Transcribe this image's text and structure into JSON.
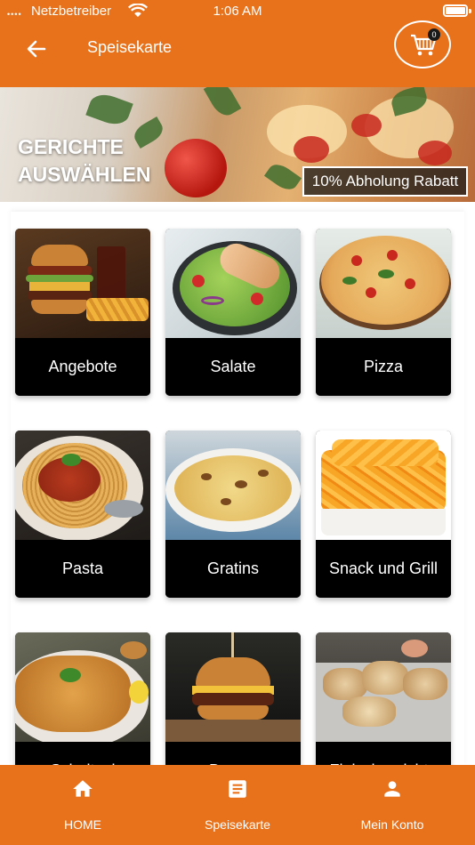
{
  "status_bar": {
    "signal": "••••",
    "carrier": "Netzbetreiber",
    "time": "1:06 AM"
  },
  "header": {
    "title": "Speisekarte",
    "cart_count": "0"
  },
  "banner": {
    "title_line1": "GERICHTE",
    "title_line2": "AUSWÄHLEN",
    "badge": "10% Abholung Rabatt"
  },
  "categories": [
    {
      "label": "Angebote"
    },
    {
      "label": "Salate"
    },
    {
      "label": "Pizza"
    },
    {
      "label": "Pasta"
    },
    {
      "label": "Gratins"
    },
    {
      "label": "Snack und Grill"
    },
    {
      "label": "Schnitzel"
    },
    {
      "label": "Burger"
    },
    {
      "label": "Fleischgerichte"
    }
  ],
  "bottom_nav": [
    {
      "label": "HOME",
      "icon": "home-icon"
    },
    {
      "label": "Speisekarte",
      "icon": "menu-list-icon"
    },
    {
      "label": "Mein Konto",
      "icon": "user-icon"
    }
  ],
  "colors": {
    "accent": "#e8721c",
    "card_label_bg": "#000000",
    "text_light": "#ffffff"
  }
}
